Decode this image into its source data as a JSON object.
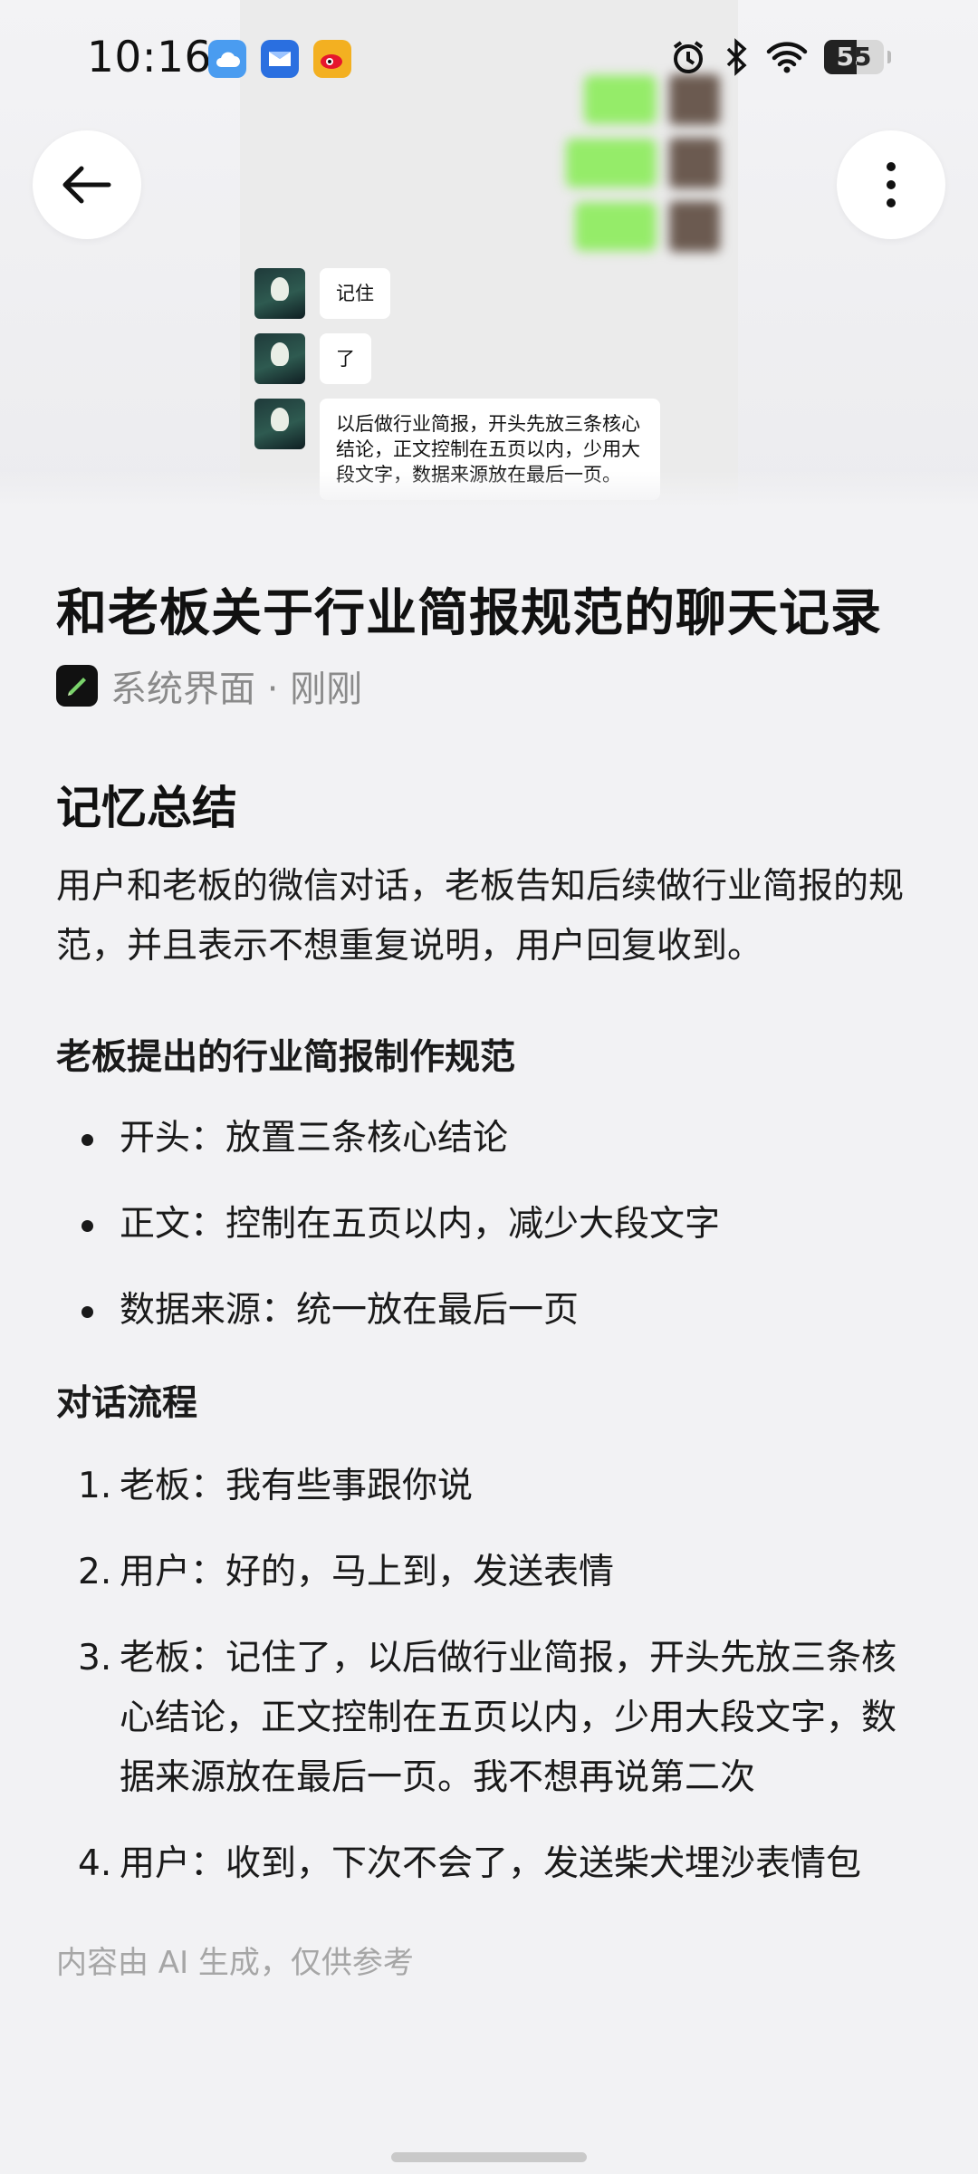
{
  "status_bar": {
    "time": "10:16",
    "battery": "55",
    "icons": [
      "cloud-icon",
      "mail-icon",
      "weibo-icon",
      "alarm-icon",
      "bluetooth-icon",
      "wifi-icon",
      "battery-icon"
    ]
  },
  "preview": {
    "messages": [
      "记住",
      "了",
      "以后做行业简报，开头先放三条核心结论，正文控制在五页以内，少用大段文字，数据来源放在最后一页。"
    ]
  },
  "header": {
    "title": "和老板关于行业简报规范的聊天记录",
    "source": "系统界面 · 刚刚"
  },
  "summary": {
    "heading": "记忆总结",
    "body": "用户和老板的微信对话，老板告知后续做行业简报的规范，并且表示不想重复说明，用户回复收到。"
  },
  "rules": {
    "heading": "老板提出的行业简报制作规范",
    "items": [
      "开头：放置三条核心结论",
      "正文：控制在五页以内，减少大段文字",
      "数据来源：统一放在最后一页"
    ]
  },
  "flow": {
    "heading": "对话流程",
    "items": [
      {
        "num": "1.",
        "text": "老板：我有些事跟你说"
      },
      {
        "num": "2.",
        "text": "用户：好的，马上到，发送表情"
      },
      {
        "num": "3.",
        "text": "老板：记住了，以后做行业简报，开头先放三条核心结论，正文控制在五页以内，少用大段文字，数据来源放在最后一页。我不想再说第二次"
      },
      {
        "num": "4.",
        "text": "用户：收到，下次不会了，发送柴犬埋沙表情包"
      }
    ]
  },
  "disclaimer": "内容由 AI 生成，仅供参考",
  "colors": {
    "background": "#f2f2f4",
    "bubble_green": "#95ec69",
    "muted": "#8a8a8a"
  }
}
